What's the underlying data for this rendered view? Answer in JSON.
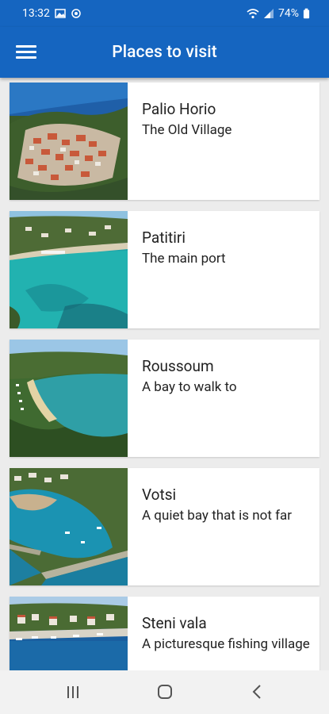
{
  "status": {
    "time": "13:32",
    "battery": "74%",
    "icons": [
      "image-icon",
      "sync-icon",
      "wifi-icon",
      "signal-icon",
      "battery-icon"
    ]
  },
  "app_bar": {
    "title": "Places to visit",
    "menu_icon": "hamburger-menu-icon"
  },
  "places": [
    {
      "title": "Palio Horio",
      "subtitle": "The Old Village"
    },
    {
      "title": "Patitiri",
      "subtitle": "The main port"
    },
    {
      "title": "Roussoum",
      "subtitle": "A bay to walk to"
    },
    {
      "title": "Votsi",
      "subtitle": "A quiet bay that is not far"
    },
    {
      "title": "Steni vala",
      "subtitle": "A picturesque fishing village"
    }
  ],
  "nav": {
    "icons": [
      "recent-apps-icon",
      "home-icon",
      "back-icon"
    ]
  },
  "colors": {
    "primary": "#1565c0",
    "background": "#ececec",
    "card": "#ffffff"
  }
}
